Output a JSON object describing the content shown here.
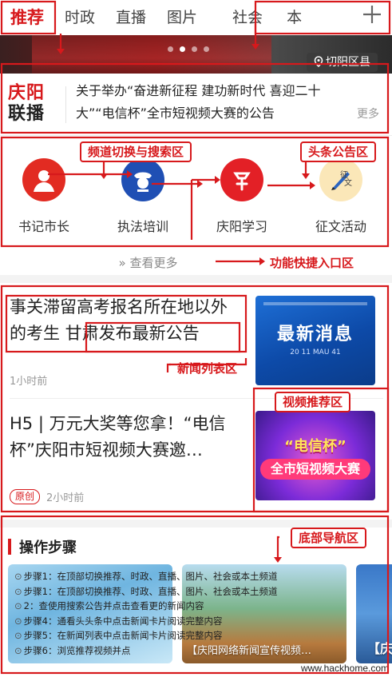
{
  "channels": {
    "tabs": [
      "推荐",
      "时政",
      "直播",
      "图片",
      "社会",
      "本"
    ],
    "more_icon": "plus-icon"
  },
  "banner": {
    "location": "切阳区县",
    "location_icon": "location-pin-icon",
    "dots": 4,
    "active_dot": 1
  },
  "notice": {
    "logo_line1": "庆阳",
    "logo_line2": "联播",
    "text": "关于举办“奋进新征程 建功新时代 喜迎二十大”“电信杯”全市短视频大赛的公告",
    "more": "更多"
  },
  "shortcuts": {
    "items": [
      {
        "label": "书记市长",
        "icon": "person-avatar-icon"
      },
      {
        "label": "执法培训",
        "icon": "police-badge-icon"
      },
      {
        "label": "庆阳学习",
        "icon": "study-emblem-icon"
      },
      {
        "label": "征文活动",
        "icon": "quill-pen-icon"
      }
    ],
    "view_more": "查看更多"
  },
  "news": [
    {
      "title": "事关滞留高考报名所在地以外的考生 甘肃发布最新公告",
      "time": "1小时前",
      "thumb_caption": "最新消息",
      "thumb_sub": "20 11 MAU 41"
    },
    {
      "title": "H5 | 万元大奖等您拿！“电信杯”庆阳市短视频大赛邀…",
      "badge": "原创",
      "time": "2小时前",
      "thumb_caption": "“电信杯”",
      "thumb_sub": "全市短视频大赛"
    }
  ],
  "steps": {
    "header": "操作步骤",
    "items": [
      "步骤1：在顶部切换推荐、时政、直播、图片、社会或本土频道",
      "步骤1：在顶部切换推荐、时政、直播、图片、社会或本土频道",
      "2：查使用搜索公告并点击查看更的新闻内容",
      "步骤4：通看头头条中点击新闻卡片阅读完整内容",
      "步骤5：在新闻列表中点击新闻卡片阅读完整内容",
      "步骤6：浏览推荐视频并点"
    ],
    "card_captions": [
      "",
      "【庆阳网络新闻宣传视频…",
      "【庆"
    ]
  },
  "annotations": {
    "channel": "频道切换与搜索区",
    "headline": "头条公告区",
    "quick": "功能快捷入口区",
    "newslist": "新闻列表区",
    "video": "视频推荐区",
    "bottomnav": "底部导航区"
  },
  "watermark": "www.hackhome.com",
  "colors": {
    "brand_red": "#d7191c",
    "text": "#222222",
    "muted": "#999999"
  }
}
